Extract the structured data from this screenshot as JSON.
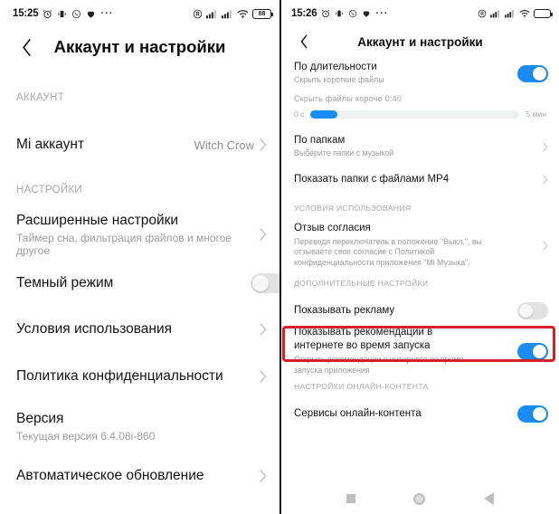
{
  "left": {
    "status": {
      "time": "15:25",
      "icons": [
        "alarm-icon",
        "vibrate-icon",
        "call-icon",
        "heart-icon"
      ],
      "overflow": "···",
      "right_icons": [
        "registered-icon",
        "signal-icon",
        "signal-icon",
        "wifi-icon"
      ],
      "battery": "88"
    },
    "appbar": {
      "back": "‹",
      "title": "Аккаунт и настройки"
    },
    "sections": [
      {
        "header": "АККАУНТ",
        "rows": [
          {
            "title": "Mi аккаунт",
            "sub": "",
            "value": "Witch Crow",
            "control": "chevron"
          }
        ]
      },
      {
        "header": "НАСТРОЙКИ",
        "rows": [
          {
            "title": "Расширенные настройки",
            "sub": "Таймер сна, фильтрация файлов и многое другое",
            "value": "",
            "control": "chevron"
          },
          {
            "title": "Темный режим",
            "sub": "",
            "value": "",
            "control": "toggle-off"
          },
          {
            "title": "Условия использования",
            "sub": "",
            "value": "",
            "control": "chevron"
          },
          {
            "title": "Политика конфиденциальности",
            "sub": "",
            "value": "",
            "control": "chevron"
          },
          {
            "title": "Версия",
            "sub": "Текущая версия 6.4.08i-860",
            "value": "",
            "control": "none"
          },
          {
            "title": "Автоматическое обновление",
            "sub": "",
            "value": "",
            "control": "chevron"
          }
        ]
      }
    ]
  },
  "right": {
    "status": {
      "time": "15:26",
      "icons": [
        "alarm-icon",
        "vibrate-icon",
        "call-icon",
        "heart-icon"
      ],
      "overflow": "···",
      "right_icons": [
        "registered-icon",
        "signal-icon",
        "signal-icon",
        "wifi-icon"
      ],
      "battery": ""
    },
    "appbar": {
      "back": "‹",
      "title": "Аккаунт и настройки"
    },
    "duration_row": {
      "title": "По длительности",
      "sub": "Скрыть короткие файлы",
      "control": "toggle-on"
    },
    "slider": {
      "label": "Скрыть файлы короче 0:40",
      "min_label": "0 с",
      "max_label": "5 мин",
      "percent": 13
    },
    "rows_top": [
      {
        "title": "По папкам",
        "sub": "Выберите папки с музыкой",
        "control": "chevron"
      },
      {
        "title": "Показать папки с файлами MP4",
        "sub": "",
        "control": "chevron"
      }
    ],
    "section_terms": {
      "header": "УСЛОВИЯ ИСПОЛЬЗОВАНИЯ",
      "row": {
        "title": "Отзыв согласия",
        "sub": "Переводя переключатель в положение \"Выкл.\", вы отзываете свое согласие с Политикой конфиденциальности приложения \"Mi Музыка\".",
        "control": "chevron"
      }
    },
    "section_extra": {
      "header": "ДОПОЛНИТЕЛЬНЫЕ НАСТРОЙКИ",
      "rows": [
        {
          "title": "Показывать рекламу",
          "sub": "",
          "control": "toggle-off",
          "highlighted": true
        },
        {
          "title": "Показывать рекомендации в интернете во время запуска",
          "sub": "Открыть рекомендации в интернете во время запуска приложения",
          "control": "toggle-on",
          "highlighted": false
        }
      ]
    },
    "section_online": {
      "header": "НАСТРОЙКИ ОНЛАЙН-КОНТЕНТА",
      "rows": [
        {
          "title": "Сервисы онлайн-контента",
          "sub": "",
          "control": "toggle-on"
        }
      ]
    },
    "navbar": [
      "recents-square-icon",
      "home-circle-icon",
      "back-triangle-icon"
    ]
  },
  "colors": {
    "accent": "#1a8cf5",
    "highlight": "#d81f26",
    "text": "#141414",
    "muted": "#9b9b9b"
  }
}
